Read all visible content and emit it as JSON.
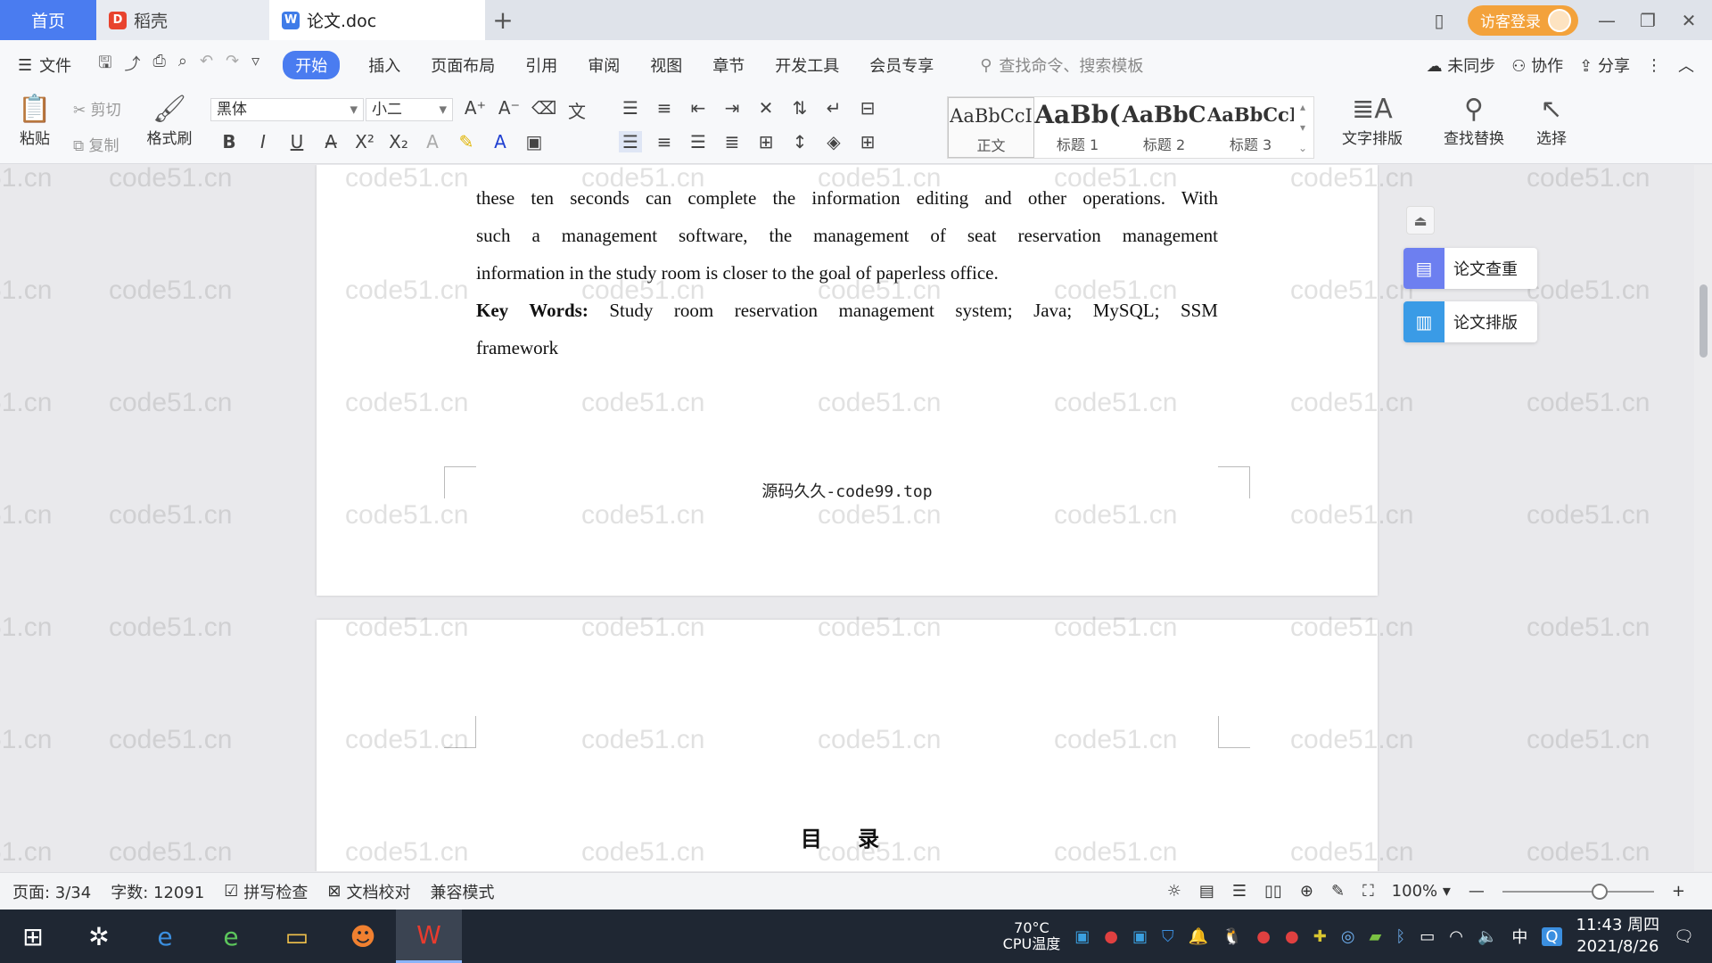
{
  "tabs": {
    "home": "首页",
    "daoke": "稻壳",
    "doc": "论文.doc",
    "add": "+"
  },
  "titlebar": {
    "login": "访客登录"
  },
  "menu": {
    "file": "文件",
    "items": [
      "开始",
      "插入",
      "页面布局",
      "引用",
      "审阅",
      "视图",
      "章节",
      "开发工具",
      "会员专享"
    ],
    "search": "查找命令、搜索模板",
    "sync": "未同步",
    "collab": "协作",
    "share": "分享"
  },
  "ribbon": {
    "paste": "粘贴",
    "cut": "剪切",
    "copy": "复制",
    "format_painter": "格式刷",
    "font_name": "黑体",
    "font_size": "小二",
    "styles": [
      {
        "sample": "AaBbCcI",
        "name": "正文"
      },
      {
        "sample": "AaBb(",
        "name": "标题 1"
      },
      {
        "sample": "AaBbC",
        "name": "标题 2"
      },
      {
        "sample": "AaBbCcI",
        "name": "标题 3"
      }
    ],
    "text_layout": "文字排版",
    "find_replace": "查找替换",
    "select": "选择"
  },
  "document": {
    "abstract_lines": [
      "these ten seconds can complete the information editing and other operations. With",
      "such a management software, the management of seat reservation management",
      "information in the study room is closer to the goal of paperless office."
    ],
    "keywords_label": "Key Words:",
    "keywords_line1": " Study room reservation management system; Java;   MySQL;   SSM",
    "keywords_line2": "framework",
    "footer": "源码久久-code99.top",
    "toc_title": "目 录",
    "watermark": "code51.cn"
  },
  "side_panel": {
    "check": "论文查重",
    "layout": "论文排版"
  },
  "status": {
    "page": "页面: 3/34",
    "words": "字数: 12091",
    "spell": "拼写检查",
    "proof": "文档校对",
    "compat": "兼容模式",
    "zoom": "100%"
  },
  "taskbar": {
    "cpu_temp": "70°C",
    "cpu_label": "CPU温度",
    "ime": "中",
    "time": "11:43 周四",
    "date": "2021/8/26"
  },
  "colors": {
    "accent": "#4a7cf0",
    "login": "#f3a23b",
    "taskbar": "#1f2733"
  }
}
